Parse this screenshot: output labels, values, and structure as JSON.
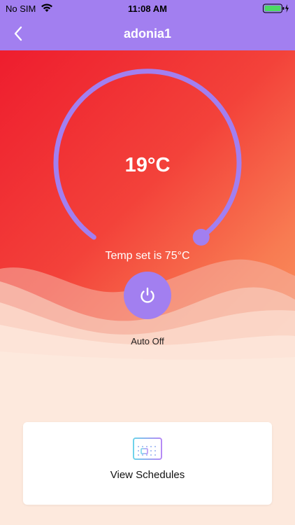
{
  "status_bar": {
    "carrier": "No SIM",
    "time": "11:08 AM"
  },
  "nav": {
    "title": "adonia1"
  },
  "thermostat": {
    "current_temp": "19°C",
    "temp_set_text": "Temp set is 75°C",
    "dial_level": 0.92
  },
  "power": {
    "label": "Auto Off"
  },
  "schedule": {
    "label": "View Schedules"
  },
  "colors": {
    "accent": "#a27ff0",
    "hero_start": "#ee1d2e",
    "hero_end": "#fb9a62",
    "background": "#fde9dd"
  },
  "icons": {
    "back": "chevron-left-icon",
    "wifi": "wifi-icon",
    "battery": "battery-charging-icon",
    "power": "power-icon",
    "calendar": "calendar-icon"
  }
}
